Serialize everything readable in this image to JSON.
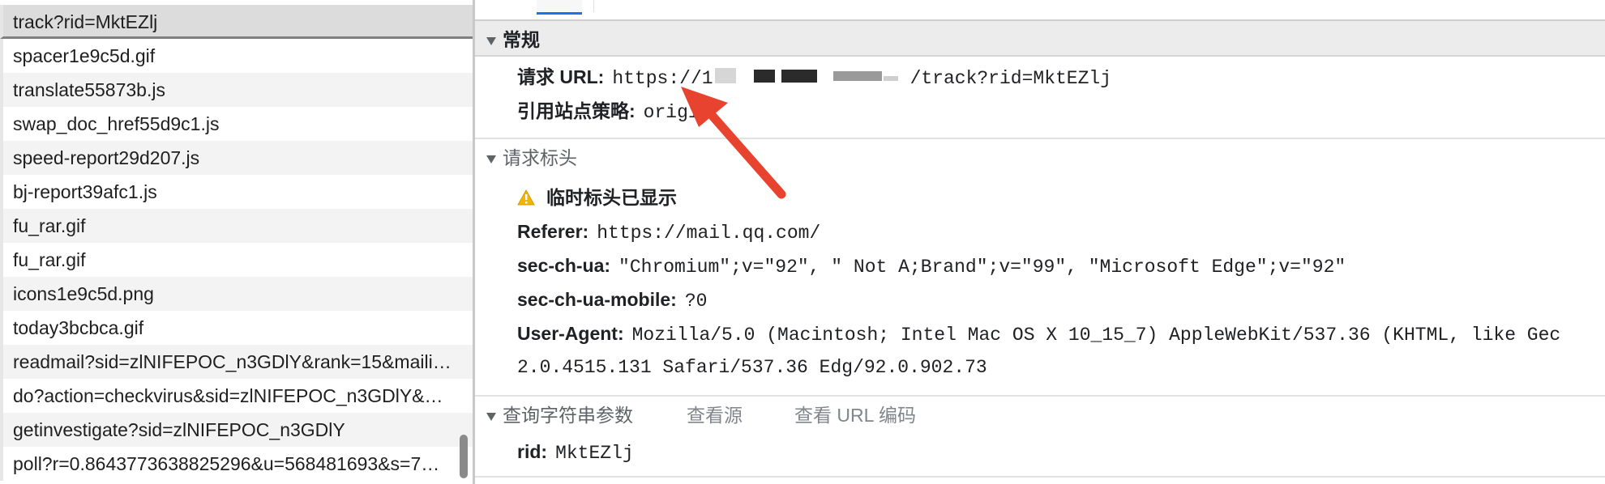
{
  "request_list": {
    "items": [
      {
        "name": "track?rid=MktEZlj",
        "selected": true
      },
      {
        "name": "spacer1e9c5d.gif"
      },
      {
        "name": "translate55873b.js"
      },
      {
        "name": "swap_doc_href55d9c1.js"
      },
      {
        "name": "speed-report29d207.js"
      },
      {
        "name": "bj-report39afc1.js"
      },
      {
        "name": "fu_rar.gif"
      },
      {
        "name": "fu_rar.gif"
      },
      {
        "name": "icons1e9c5d.png"
      },
      {
        "name": "today3bcbca.gif"
      },
      {
        "name": "readmail?sid=zlNIFEPOC_n3GDlY&rank=15&maili…"
      },
      {
        "name": "do?action=checkvirus&sid=zlNIFEPOC_n3GDlY&…"
      },
      {
        "name": "getinvestigate?sid=zlNIFEPOC_n3GDlY"
      },
      {
        "name": "poll?r=0.8643773638825296&u=568481693&s=7…"
      }
    ]
  },
  "general": {
    "title": "常规",
    "request_url_label": "请求 URL:",
    "request_url_prefix": "https://1",
    "request_url_suffix": "/track?rid=MktEZlj",
    "referrer_policy_label": "引用站点策略:",
    "referrer_policy_value": "origin"
  },
  "request_headers": {
    "title": "请求标头",
    "warning": "临时标头已显示",
    "rows": [
      {
        "label": "Referer:",
        "value": "https://mail.qq.com/"
      },
      {
        "label": "sec-ch-ua:",
        "value": "\"Chromium\";v=\"92\", \" Not A;Brand\";v=\"99\", \"Microsoft Edge\";v=\"92\""
      },
      {
        "label": "sec-ch-ua-mobile:",
        "value": "?0"
      },
      {
        "label": "User-Agent:",
        "value": "Mozilla/5.0 (Macintosh; Intel Mac OS X 10_15_7) AppleWebKit/537.36 (KHTML, like Gec",
        "continuation": "2.0.4515.131 Safari/537.36 Edg/92.0.902.73"
      }
    ]
  },
  "query_params": {
    "title": "查询字符串参数",
    "view_source": "查看源",
    "view_url_encoded": "查看 URL 编码",
    "rows": [
      {
        "label": "rid:",
        "value": "MktEZlj"
      }
    ]
  },
  "colors": {
    "arrow": "#e8432f",
    "tab_active": "#1a73e8",
    "warning": "#f2b600"
  }
}
